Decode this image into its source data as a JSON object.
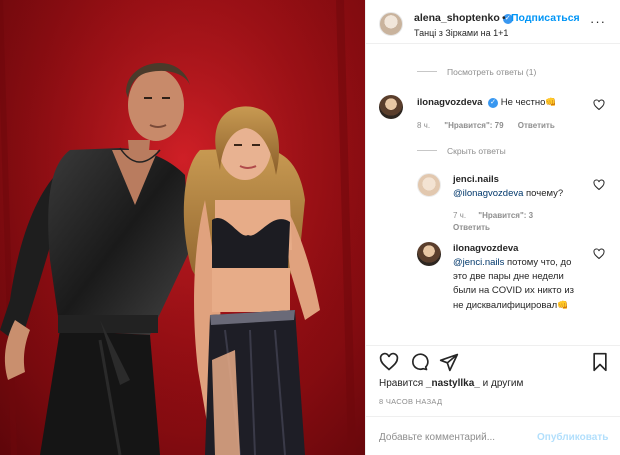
{
  "header": {
    "username": "alena_shoptenko",
    "separator": "•",
    "follow_label": "Подписаться",
    "location": "Танці з Зірками на 1+1",
    "more_glyph": "···"
  },
  "thread": {
    "show_replies": "Посмотреть ответы (1)",
    "comment": {
      "username": "ilonagvozdeva",
      "text": "Не честно",
      "emoji": "👊",
      "age": "8 ч.",
      "likes": "\"Нравится\": 79",
      "reply": "Ответить"
    },
    "hide_replies": "Скрыть ответы",
    "reply1": {
      "username": "jenci.nails",
      "mention": "@ilonagvozdeva",
      "text": " почему?",
      "age": "7 ч.",
      "likes": "\"Нравится\": 3",
      "reply": "Ответить"
    },
    "reply2": {
      "username": "ilonagvozdeva",
      "mention": "@jenci.nails",
      "text": " потому что, до это две пары дне недели были на COVID их никто из не дисквалифицировал",
      "emoji": "👊"
    }
  },
  "actions": {
    "likes_prefix": "Нравится ",
    "liked_by": "_nastyllka_",
    "likes_suffix": " и другим",
    "posted_ago": "8 ЧАСОВ НАЗАД"
  },
  "composer": {
    "placeholder": "Добавьте комментарий...",
    "publish": "Опубликовать"
  },
  "colors": {
    "accent": "#0095f6",
    "mention": "#00376b",
    "muted": "#8e8e8e",
    "photo_background": "#9b0f14"
  }
}
